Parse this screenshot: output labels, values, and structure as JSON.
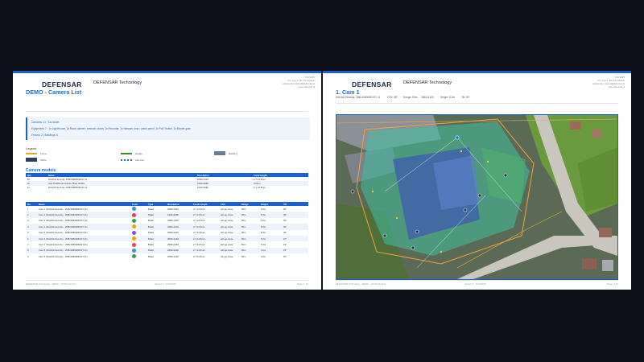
{
  "left": {
    "logo": "DEFENSAR",
    "company": "DEFENSAR Technology",
    "title": "DEMO - Camera List",
    "address": [
      "5/10/2025",
      "Trzy Lipy 3, 80-172 Gdańsk",
      "aleksander.vorkoal@defensar.pl",
      "www.defensar.pl"
    ],
    "info": {
      "line1": "Cameras: 11  ·  11x bullet",
      "line2": "Equipment: 7  ·  2x LightHouse, 1x Rack cabinet / network closet, 1x Recorder, 1x Network drop / patch panel, 1x PoE Switch, 1x Border gate",
      "line3": "Fences: 2  |  Buildings: 6"
    },
    "legend": {
      "title": "Legend",
      "items": [
        {
          "label": "Fence",
          "color": "#f0a23a"
        },
        {
          "label": "Hedge",
          "color": "#3c8b3c"
        },
        {
          "label": "Building",
          "color": "#6b7a90"
        },
        {
          "label": "Office",
          "color": "#2b3f66"
        },
        {
          "label": "ethernet",
          "color": "#1f6fd4"
        }
      ]
    },
    "models": {
      "title": "Camera models",
      "headers": [
        "Qty",
        "Name",
        "Resolution",
        "Focal length"
      ],
      "rows": [
        [
          "8x",
          "DAHUA Security, ZNB-5080IMD1ST-J1",
          "2560x1440",
          "2.7-13.5mm"
        ],
        [
          "2x",
          "Axis P1465-LE License Plate Verifier",
          "1920x1080",
          "3.6mm"
        ],
        [
          "1x",
          "DAHUA Security, ZNB-5080IMD1ST-J1",
          "1920x1080",
          "2.7-13.5mm"
        ]
      ]
    },
    "cameras": {
      "headers": [
        "No.",
        "Name",
        "Color",
        "Type",
        "Resolution",
        "Focal Length",
        "FOV",
        "Range",
        "Height",
        "Tilt"
      ],
      "rows": [
        {
          "no": "1",
          "name": "Cam 1 (DAHUA Security - ZNB-5080IMD1ST-J1)",
          "color": "#3a8de0",
          "type": "Bullet",
          "res": "2560x1440",
          "focal": "2.7-13.5mm",
          "fov": "wirt.go.close",
          "range": "50m",
          "height": "5.0m",
          "tilt": "30°"
        },
        {
          "no": "2",
          "name": "Cam 2 (DAHUA Security - ZNB-5080IMD1ST-J1)",
          "color": "#e64545",
          "type": "Bullet",
          "res": "1920x1080",
          "focal": "2.7-13.5mm",
          "fov": "wirt.go.close",
          "range": "35m",
          "height": "5.0m",
          "tilt": "30°"
        },
        {
          "no": "3",
          "name": "Cam 3 (DAHUA Security - ZNB-5080IMD1ST-J1)",
          "color": "#2e9e4a",
          "type": "Bullet",
          "res": "2560x1440",
          "focal": "2.7-13.5mm",
          "fov": "wirt.go.close",
          "range": "50m",
          "height": "5.0m",
          "tilt": "30°"
        },
        {
          "no": "4",
          "name": "Cam 4 (DAHUA Security - ZNB-5080IMD1ST-J1)",
          "color": "#e6a400",
          "type": "Bullet",
          "res": "2560x1440",
          "focal": "2.7-13.5mm",
          "fov": "wirt.go.close",
          "range": "50m",
          "height": "5.0m",
          "tilt": "30°"
        },
        {
          "no": "5",
          "name": "Cam 5 (DAHUA Security - ZNB-5080IMD1ST-J1)",
          "color": "#8a4be0",
          "type": "Bullet",
          "res": "2560x1440",
          "focal": "2.7-13.5mm",
          "fov": "wirt.go.close",
          "range": "50m",
          "height": "5.0m",
          "tilt": "30°"
        },
        {
          "no": "6",
          "name": "Cam 6 (DAHUA Security - ZNB-5080IMD1ST-J1)",
          "color": "#e6a400",
          "type": "Bullet",
          "res": "2560x1440",
          "focal": "2.7-13.5mm",
          "fov": "wirt.go.close",
          "range": "50m",
          "height": "5.0m",
          "tilt": "15°"
        },
        {
          "no": "7",
          "name": "Cam 7 (DAHUA Security - ZNB-5080IMD1ST-J1)",
          "color": "#e64545",
          "type": "Bullet",
          "res": "2560x1440",
          "focal": "2.7-13.5mm",
          "fov": "wirt.go.close",
          "range": "50m",
          "height": "5.0m",
          "tilt": "15°"
        },
        {
          "no": "8",
          "name": "Cam 8 (DAHUA Security - ZNB-5080IMD1ST-J1)",
          "color": "#3a8de0",
          "type": "Bullet",
          "res": "2560x1440",
          "focal": "2.7-13.5mm",
          "fov": "wirt.go.close",
          "range": "50m",
          "height": "4.0m",
          "tilt": "15°"
        },
        {
          "no": "9",
          "name": "Cam 9 (DAHUA Security - ZNB-5080IMD1ST-J1)",
          "color": "#2e9e4a",
          "type": "Bullet",
          "res": "2560x1440",
          "focal": "2.7-13.5mm",
          "fov": "wirt.go.close",
          "range": "50m",
          "height": "4.0m",
          "tilt": "15°"
        }
      ]
    },
    "footer_left": "DEFENSAR Technology · DEMO · GZTSystemUA",
    "footer_mid": "Version 1 · 5/10/2025",
    "footer_right": "Page 1 / 12"
  },
  "right": {
    "logo": "DEFENSAR",
    "company": "DEFENSAR Technology",
    "title": "1. Cam 1",
    "address": [
      "5/10/2025",
      "Trzy Lipy 3, 80-172 Gdańsk",
      "aleksander.vorkoal@defensar.pl",
      "www.defensar.pl"
    ],
    "specs": [
      "DAHUA Security, ZNB-5080IMD1ST-J1",
      "FOV: 88°",
      "Range: 50m",
      "2560x1440",
      "Height: 5.0m",
      "Tilt: 30°"
    ],
    "footer_left": "DEFENSAR Technology · DEMO · GZTSystemUA",
    "footer_mid": "Version 1 · 5/10/2025",
    "footer_right": "Page 2 / 12"
  }
}
